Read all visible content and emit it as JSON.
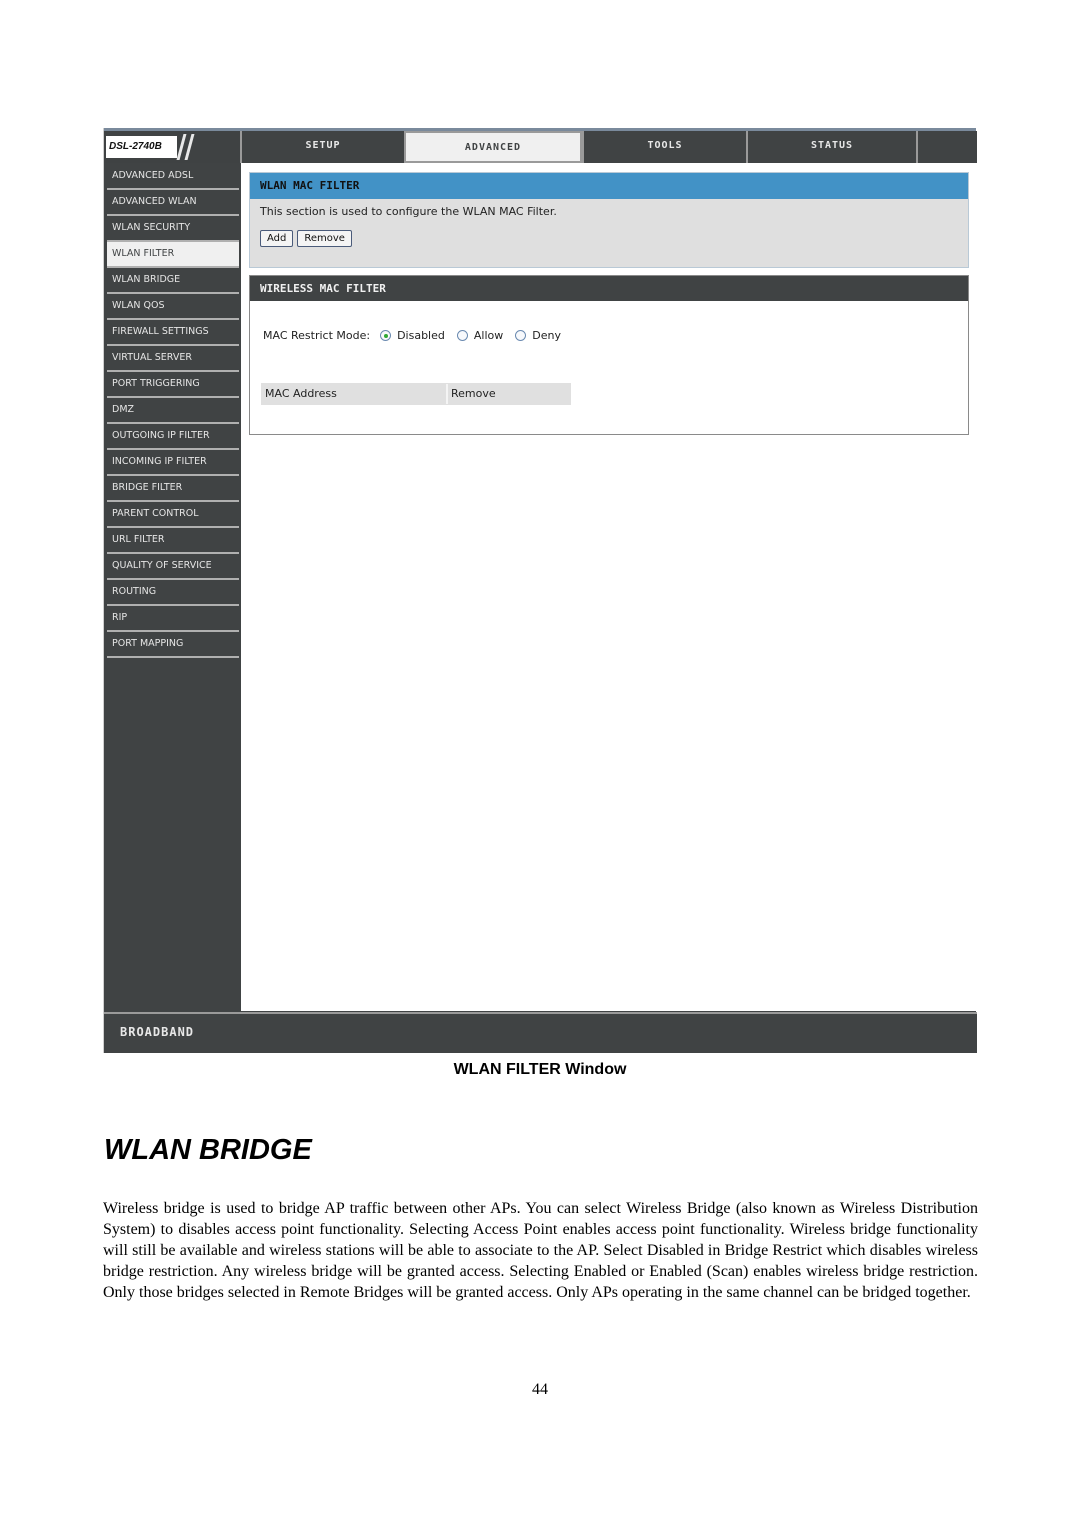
{
  "router_ui": {
    "model": "DSL-2740B",
    "tabs": [
      {
        "label": "SETUP",
        "active": false
      },
      {
        "label": "ADVANCED",
        "active": true
      },
      {
        "label": "TOOLS",
        "active": false
      },
      {
        "label": "STATUS",
        "active": false
      },
      {
        "label": "",
        "active": false
      }
    ],
    "sidebar": [
      {
        "label": "ADVANCED ADSL",
        "active": false
      },
      {
        "label": "ADVANCED WLAN",
        "active": false
      },
      {
        "label": "WLAN SECURITY",
        "active": false
      },
      {
        "label": "WLAN FILTER",
        "active": true
      },
      {
        "label": "WLAN BRIDGE",
        "active": false
      },
      {
        "label": "WLAN QOS",
        "active": false
      },
      {
        "label": "FIREWALL SETTINGS",
        "active": false
      },
      {
        "label": "VIRTUAL SERVER",
        "active": false
      },
      {
        "label": "PORT TRIGGERING",
        "active": false
      },
      {
        "label": "DMZ",
        "active": false
      },
      {
        "label": "OUTGOING IP FILTER",
        "active": false
      },
      {
        "label": "INCOMING IP FILTER",
        "active": false
      },
      {
        "label": "BRIDGE FILTER",
        "active": false
      },
      {
        "label": "PARENT CONTROL",
        "active": false
      },
      {
        "label": "URL FILTER",
        "active": false
      },
      {
        "label": "QUALITY OF SERVICE",
        "active": false
      },
      {
        "label": "ROUTING",
        "active": false
      },
      {
        "label": "RIP",
        "active": false
      },
      {
        "label": "PORT MAPPING",
        "active": false
      }
    ],
    "wlan_mac_filter": {
      "title": "WLAN MAC FILTER",
      "description": "This section is used to configure the WLAN MAC Filter.",
      "add_label": "Add",
      "remove_label": "Remove"
    },
    "wireless_mac_filter": {
      "title": "WIRELESS MAC FILTER",
      "mode_label": "MAC Restrict Mode:",
      "modes": [
        {
          "label": "Disabled",
          "checked": true
        },
        {
          "label": "Allow",
          "checked": false
        },
        {
          "label": "Deny",
          "checked": false
        }
      ],
      "table_headers": [
        "MAC Address",
        "Remove"
      ]
    },
    "footer_brand": "BROADBAND",
    "colors": {
      "accent_blue": "#4292c6",
      "dark_bar": "#404344",
      "radio_selected": "#2fa836"
    }
  },
  "document": {
    "caption": "WLAN FILTER Window",
    "section_title": "WLAN BRIDGE",
    "paragraph": "Wireless bridge is used to bridge AP traffic between other APs. You can select Wireless Bridge (also known as Wireless Distribution System) to disables access point functionality. Selecting Access Point enables access point functionality. Wireless bridge functionality will still be available and wireless stations will be able to associate to the AP. Select Disabled in Bridge Restrict which disables wireless bridge restriction. Any wireless bridge will be granted access. Selecting Enabled or Enabled (Scan) enables wireless bridge restriction. Only those bridges selected in Remote Bridges will be granted access. Only APs operating in the same channel can be bridged together.",
    "page_number": "44"
  }
}
